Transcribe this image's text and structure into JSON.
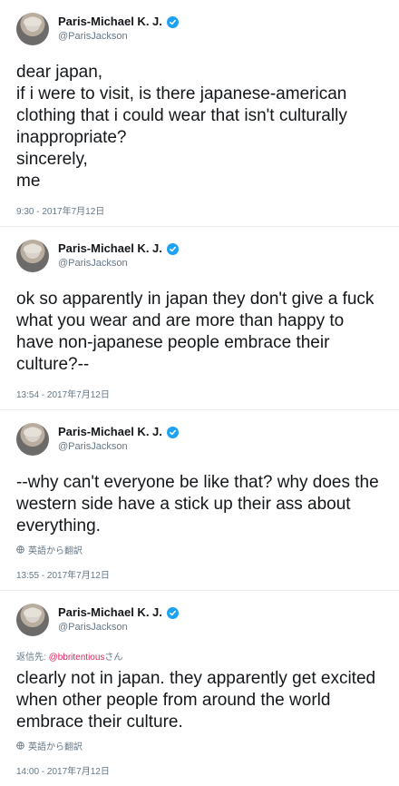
{
  "tweets": [
    {
      "display_name": "Paris-Michael K. J.",
      "handle": "@ParisJackson",
      "text": "dear japan,\nif i were to visit, is there japanese-american clothing that i could wear that isn't culturally inappropriate?\nsincerely,\nme",
      "timestamp": "9:30 - 2017年7月12日"
    },
    {
      "display_name": "Paris-Michael K. J.",
      "handle": "@ParisJackson",
      "text": "ok so apparently in japan they don't give a fuck what you wear and are more than happy to have non-japanese people embrace their culture?--",
      "timestamp": "13:54 - 2017年7月12日"
    },
    {
      "display_name": "Paris-Michael K. J.",
      "handle": "@ParisJackson",
      "text": "--why can't everyone be like that? why does the western side have a stick up their ass about everything.",
      "translate": "英語から翻訳",
      "timestamp": "13:55 - 2017年7月12日"
    },
    {
      "display_name": "Paris-Michael K. J.",
      "handle": "@ParisJackson",
      "reply_prefix": "返信先: ",
      "reply_mention": "@bbritentious",
      "reply_suffix": "さん",
      "text": "clearly not in japan. they apparently get excited when other people from around the world embrace their culture.",
      "translate": "英語から翻訳",
      "timestamp": "14:00 - 2017年7月12日"
    }
  ]
}
